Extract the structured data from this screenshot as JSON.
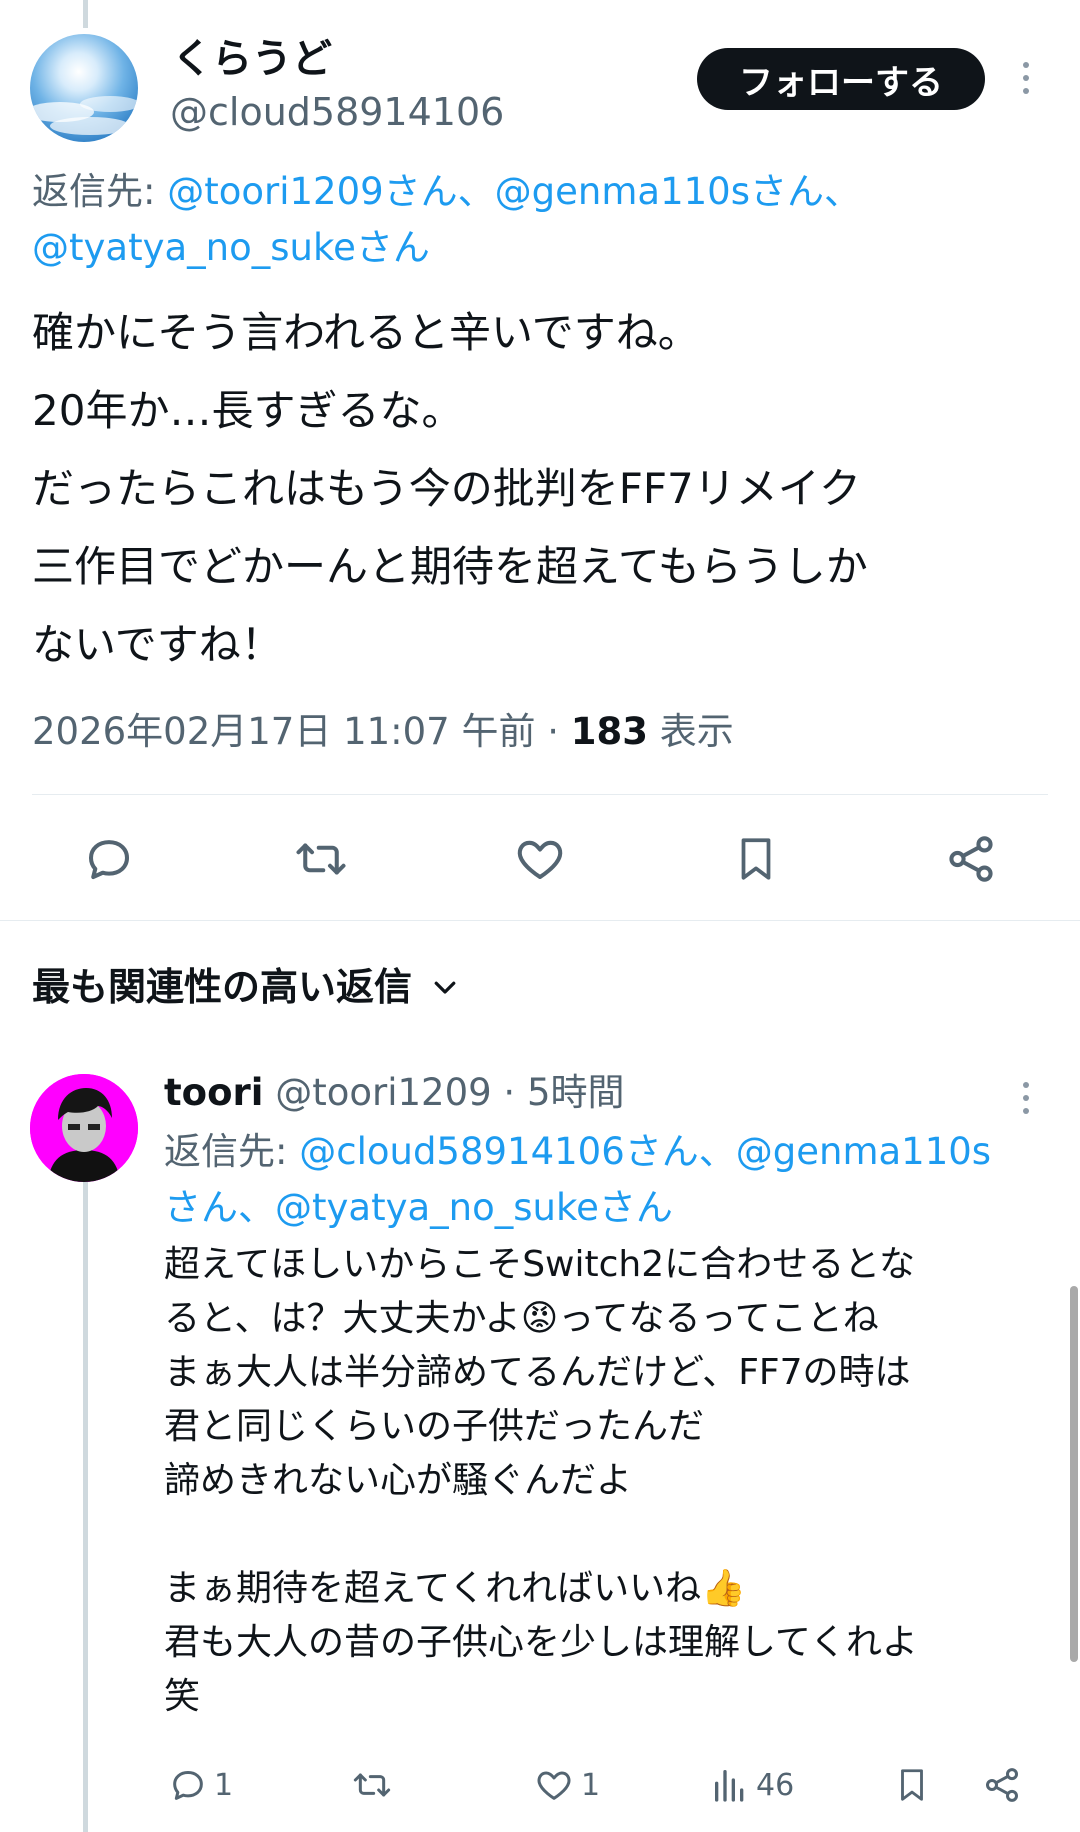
{
  "tweet": {
    "display_name": "くらうど",
    "handle": "@cloud58914106",
    "follow_label": "フォローする",
    "reply_prefix": "返信先: ",
    "reply_targets": [
      "@toori1209さん",
      "@genma110sさん",
      "@tyatya_no_sukeさん"
    ],
    "separator": "、",
    "body": "確かにそう言われると辛いですね。\n20年か…長すぎるな。\nだったらこれはもう今の批判をFF7リメイク\n三作目でどかーんと期待を超えてもらうしか\nないですね！",
    "timestamp": "2026年02月17日 11:07 午前",
    "dot": " · ",
    "views": "183",
    "views_label": " 表示"
  },
  "relevant_replies_label": "最も関連性の高い返信",
  "reply": {
    "display_name": "toori",
    "handle": "@toori1209",
    "time": " · 5時間",
    "reply_prefix": "返信先: ",
    "reply_targets": [
      "@cloud58914106さん",
      "@genma110s",
      "さん",
      "@tyatya_no_sukeさん"
    ],
    "body": "超えてほしいからこそSwitch2に合わせるとな\nると、は？大丈夫かよ😡ってなるってことね\nまぁ大人は半分諦めてるんだけど、FF7の時は\n君と同じくらいの子供だったんだ\n諦めきれない心が騒ぐんだよ\n\nまぁ期待を超えてくれればいいね👍\n君も大人の昔の子供心を少しは理解してくれよ\n笑",
    "reply_count": "1",
    "like_count": "1",
    "view_count": "46"
  },
  "icons": {
    "reply": "reply-icon",
    "retweet": "retweet-icon",
    "like": "heart-icon",
    "bookmark": "bookmark-icon",
    "share": "share-icon",
    "views": "views-icon",
    "more": "more-icon",
    "chevron": "chevron-down-icon"
  },
  "colors": {
    "link": "#1d9bf0",
    "secondary": "#536471",
    "primary": "#0f1419",
    "avatar2_bg": "#ff00ff"
  }
}
